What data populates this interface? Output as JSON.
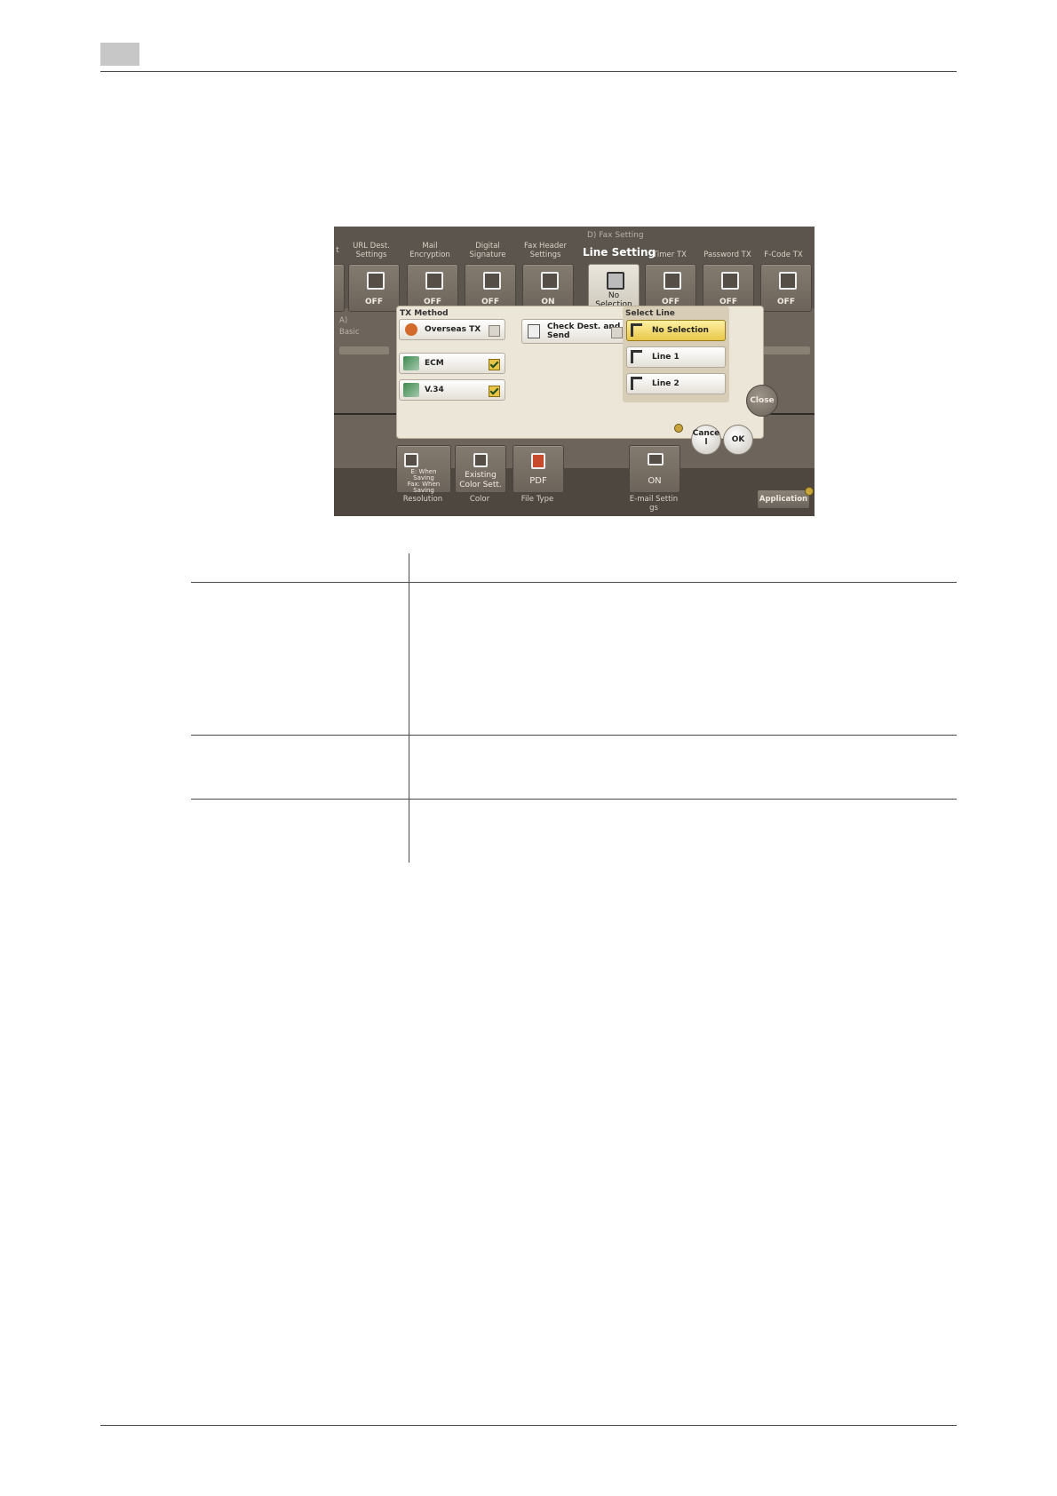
{
  "screen": {
    "section_caption": "D)   Fax Setting",
    "title": "Line Setting",
    "top_tiles": [
      {
        "header": "URL Dest.\nSettings",
        "value": "OFF",
        "icon": "laptop-icon"
      },
      {
        "header": "Mail\nEncryption",
        "value": "OFF",
        "icon": "key-icon"
      },
      {
        "header": "Digital\nSignature",
        "value": "OFF",
        "icon": "signature-icon"
      },
      {
        "header": "Fax Header\nSettings",
        "value": "ON",
        "icon": "fax-header-icon"
      },
      {
        "header": "Timer TX",
        "value": "OFF",
        "icon": "timer-icon"
      },
      {
        "header": "Password TX",
        "value": "OFF",
        "icon": "password-icon"
      },
      {
        "header": "F-Code TX",
        "value": "OFF",
        "icon": "fcode-icon"
      }
    ],
    "no_selection_tile": "No\nSelection",
    "left_partial_header": "t",
    "left_partial_value": "A)\nBasic",
    "dialog": {
      "tx_method_label": "TX Method",
      "overseas_tx": "Overseas TX",
      "check_dest": "Check Dest. and\nSend",
      "ecm": "ECM",
      "v34": "V.34",
      "select_line_label": "Select Line",
      "line_no_selection": "No Selection",
      "line1": "Line 1",
      "line2": "Line 2",
      "cancel": "Cance\nl",
      "ok": "OK"
    },
    "close": "Close",
    "application": "Application",
    "bottom_tiles": [
      {
        "value": "E: When\nSaving\nFax: When\nSaving",
        "label": "Resolution"
      },
      {
        "value": "Existing\nColor Sett.",
        "label": "Color"
      },
      {
        "value": "PDF",
        "label": "File Type"
      },
      {
        "value": "ON",
        "label": "E-mail Settin\ngs"
      }
    ]
  }
}
